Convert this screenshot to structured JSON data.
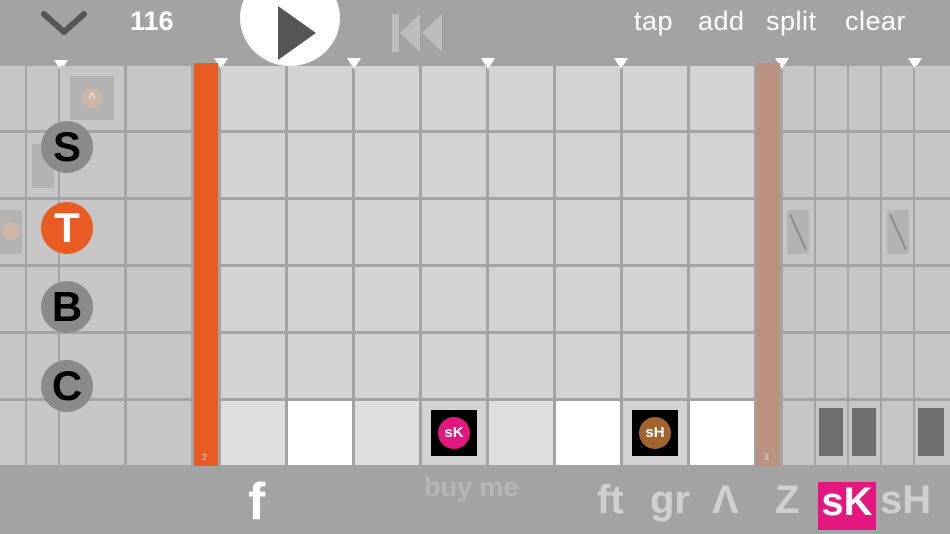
{
  "toolbar": {
    "tempo": "116",
    "tap_label": "tap",
    "add_label": "add",
    "split_label": "split",
    "clear_label": "clear"
  },
  "voices": [
    {
      "label": "S",
      "active": false
    },
    {
      "label": "T",
      "active": true
    },
    {
      "label": "B",
      "active": false
    },
    {
      "label": "C",
      "active": false
    }
  ],
  "sequence": {
    "current_bar": "2",
    "next_bar": "3"
  },
  "tiles": {
    "sk": "sK",
    "sh": "sH"
  },
  "bottom": {
    "f_label": "f",
    "buy_label": "buy me",
    "ft_label": "ft",
    "gr_label": "gr",
    "up_label": "Λ",
    "z_label": "Z",
    "sk_label": "sK",
    "sh_label": "sH"
  },
  "colors": {
    "accent": "#e85c23",
    "playhead_ghost": "#b99282",
    "sk_pink": "#e4177f",
    "sh_brown": "#a0642c",
    "background": "#a3a3a3"
  }
}
